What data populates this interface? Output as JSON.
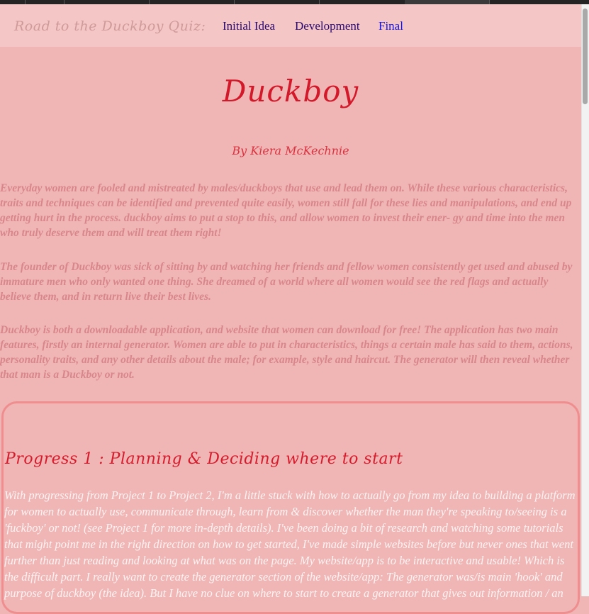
{
  "nav": {
    "brand": "Road to the Duckboy Quiz:",
    "links": [
      {
        "label": "Initial Idea"
      },
      {
        "label": "Development"
      },
      {
        "label": "Final"
      }
    ]
  },
  "header": {
    "title": "Duckboy",
    "author": "By Kiera McKechnie"
  },
  "intro": {
    "paragraphs": [
      "Everyday women are fooled and mistreated by males/duckboys that use and lead them on. While these various characteristics, traits and techniques can be identified and prevented quite easily, women still fall for these lies and manipulations, and end up getting hurt in the process. duckboy aims to put a stop to this, and allow women to invest their ener- gy and time into the men who truly deserve them and will treat them right!",
      "The founder of Duckboy was sick of sitting by and watching her friends and fellow women consistently get used and abused by immature men who only wanted one thing. She dreamed of a world where all women would see the red flags and actually believe them, and in return live their best lives.",
      "Duckboy is both a downloadable application, and website that women can download for free! The application has two main features, firstly an internal generator. Women are able to put in characteristics, things a certain male has said to them, actions, personality traits, and any other details about the male; for example, style and haircut. The generator will then reveal whether that man is a Duckboy or not."
    ]
  },
  "progress": {
    "heading": "Progress 1 : Planning & Deciding where to start",
    "text": "With progressing from Project 1 to Project 2, I'm a little stuck with how to actually go from my idea to building a platform for women to actually use, communicate through, learn from & discover whether the man they're speaking to/seeing is a 'fuckboy' or not! (see Project 1 for more in-depth details). I've been doing a bit of research and watching some tutorials that might point me in the right direction on how to get started, I've made simple websites before but never ones that went further than just reading and looking at what was on the page. My website/app is to be interactive and usable! Which is the difficult part. I really want to create the generator section of the website/app: The generator was/is main 'hook' and purpose of duckboy (the idea). But I have no clue on where to start to create a generator that gives out information / an"
  },
  "colors": {
    "page_background": "#efb6b5",
    "nav_background": "#f4c6c5",
    "title_red": "#d3182a",
    "card_border": "#ef8d8f",
    "body_text": "#d9868b",
    "card_text": "#fdf3f3"
  }
}
